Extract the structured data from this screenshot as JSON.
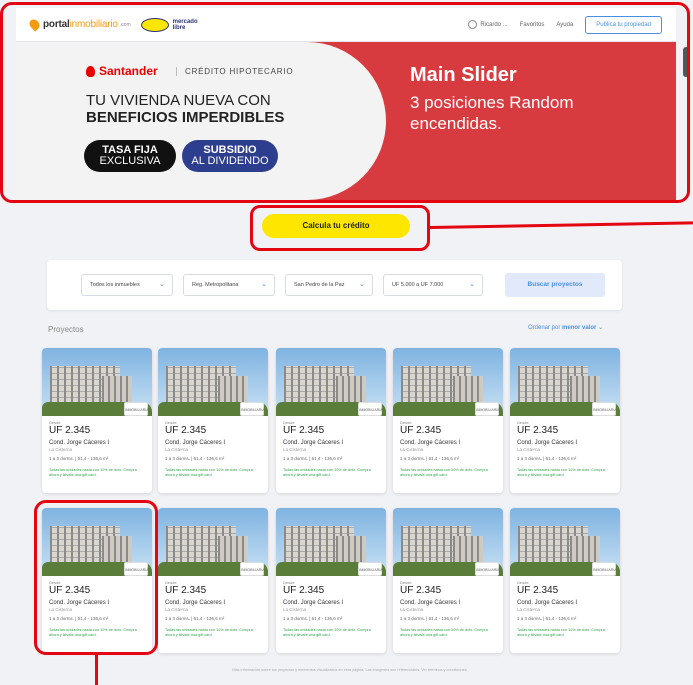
{
  "header": {
    "logo_main": "portal",
    "logo_in": "inmobiliario",
    "logo_sub": ".com",
    "partner_logo": "mercado libre",
    "user_label": "Ricardo ...",
    "favorites_label": "Favoritos",
    "help_label": "Ayuda",
    "publish_label": "Publica tu propiedad"
  },
  "hero": {
    "brand": "Santander",
    "product": "CRÉDITO HIPOTECARIO",
    "title_line1": "TU VIVIENDA NUEVA CON",
    "title_line2": "BENEFICIOS IMPERDIBLES",
    "pill1_line1": "TASA FIJA",
    "pill1_line2": "EXCLUSIVA",
    "pill2_line1": "SUBSIDIO",
    "pill2_line2": "AL DIVIDENDO"
  },
  "annotation": {
    "slider_title": "Main Slider",
    "slider_desc": "3 posiciones Random encendidas."
  },
  "calc_button": "Calcula tu crédito",
  "search": {
    "property_type": "Todos los inmuebles",
    "region": "Reg. Metropolitana",
    "commune": "San Pedro de la Paz",
    "price_range": "UF 5.000 a UF 7.000",
    "search_button": "Buscar proyectos"
  },
  "listing": {
    "section_label": "Proyectos",
    "order_prefix": "Ordenar por",
    "order_value": "menor valor"
  },
  "cards": [
    {
      "badge": "INMOBILIARIA",
      "desde": "Desde",
      "price": "UF 2.345",
      "name": "Cond. Jorge Cáceres I",
      "location": "La Cisterna",
      "specs": "1 a 3 dorms. | 61,4 - 136,6 m²",
      "promo": "Todas las unidades hasta con 10% de dcto. Compra ahora y llévate una gift card."
    },
    {
      "badge": "INMOBILIARIA",
      "desde": "Desde",
      "price": "UF 2.345",
      "name": "Cond. Jorge Cáceres I",
      "location": "La Cisterna",
      "specs": "1 a 3 dorms. | 61,4 - 136,6 m²",
      "promo": "Todas las unidades hasta con 10% de dcto. Compra ahora y llévate una gift card."
    },
    {
      "badge": "INMOBILIARIA",
      "desde": "Desde",
      "price": "UF 2.345",
      "name": "Cond. Jorge Cáceres I",
      "location": "La Cisterna",
      "specs": "1 a 3 dorms. | 61,4 - 136,6 m²",
      "promo": "Todas las unidades hasta con 10% de dcto. Compra ahora y llévate una gift card."
    },
    {
      "badge": "INMOBILIARIA",
      "desde": "Desde",
      "price": "UF 2.345",
      "name": "Cond. Jorge Cáceres I",
      "location": "La Cisterna",
      "specs": "1 a 3 dorms. | 61,4 - 136,6 m²",
      "promo": "Todas las unidades hasta con 10% de dcto. Compra ahora y llévate una gift card."
    },
    {
      "badge": "INMOBILIARIA",
      "desde": "Desde",
      "price": "UF 2.345",
      "name": "Cond. Jorge Cáceres I",
      "location": "La Cisterna",
      "specs": "1 a 3 dorms. | 61,4 - 136,6 m²",
      "promo": "Todas las unidades hasta con 10% de dcto. Compra ahora y llévate una gift card."
    },
    {
      "badge": "INMOBILIARIA",
      "desde": "Desde",
      "price": "UF 2.345",
      "name": "Cond. Jorge Cáceres I",
      "location": "La Cisterna",
      "specs": "1 a 3 dorms. | 61,4 - 136,6 m²",
      "promo": "Todas las unidades hasta con 10% de dcto. Compra ahora y llévate una gift card."
    },
    {
      "badge": "INMOBILIARIA",
      "desde": "Desde",
      "price": "UF 2.345",
      "name": "Cond. Jorge Cáceres I",
      "location": "La Cisterna",
      "specs": "1 a 3 dorms. | 61,4 - 136,6 m²",
      "promo": "Todas las unidades hasta con 10% de dcto. Compra ahora y llévate una gift card."
    },
    {
      "badge": "INMOBILIARIA",
      "desde": "Desde",
      "price": "UF 2.345",
      "name": "Cond. Jorge Cáceres I",
      "location": "La Cisterna",
      "specs": "1 a 3 dorms. | 61,4 - 136,6 m²",
      "promo": "Todas las unidades hasta con 10% de dcto. Compra ahora y llévate una gift card."
    },
    {
      "badge": "INMOBILIARIA",
      "desde": "Desde",
      "price": "UF 2.345",
      "name": "Cond. Jorge Cáceres I",
      "location": "La Cisterna",
      "specs": "1 a 3 dorms. | 61,4 - 136,6 m²",
      "promo": "Todas las unidades hasta con 10% de dcto. Compra ahora y llévate una gift card."
    },
    {
      "badge": "INMOBILIARIA",
      "desde": "Desde",
      "price": "UF 2.345",
      "name": "Cond. Jorge Cáceres I",
      "location": "La Cisterna",
      "specs": "1 a 3 dorms. | 61,4 - 136,6 m²",
      "promo": "Todas las unidades hasta con 10% de dcto. Compra ahora y llévate una gift card."
    }
  ],
  "footer_note": "Más información sobre los proyectos y elementos visualizados en esta página. Las imágenes son referenciales. Ver términos y condiciones.",
  "colors": {
    "accent_red": "#d83b3f",
    "annotation_red": "#e30613",
    "calc_yellow": "#ffe600",
    "link_blue": "#4a90e2",
    "promo_green": "#2da44e"
  }
}
